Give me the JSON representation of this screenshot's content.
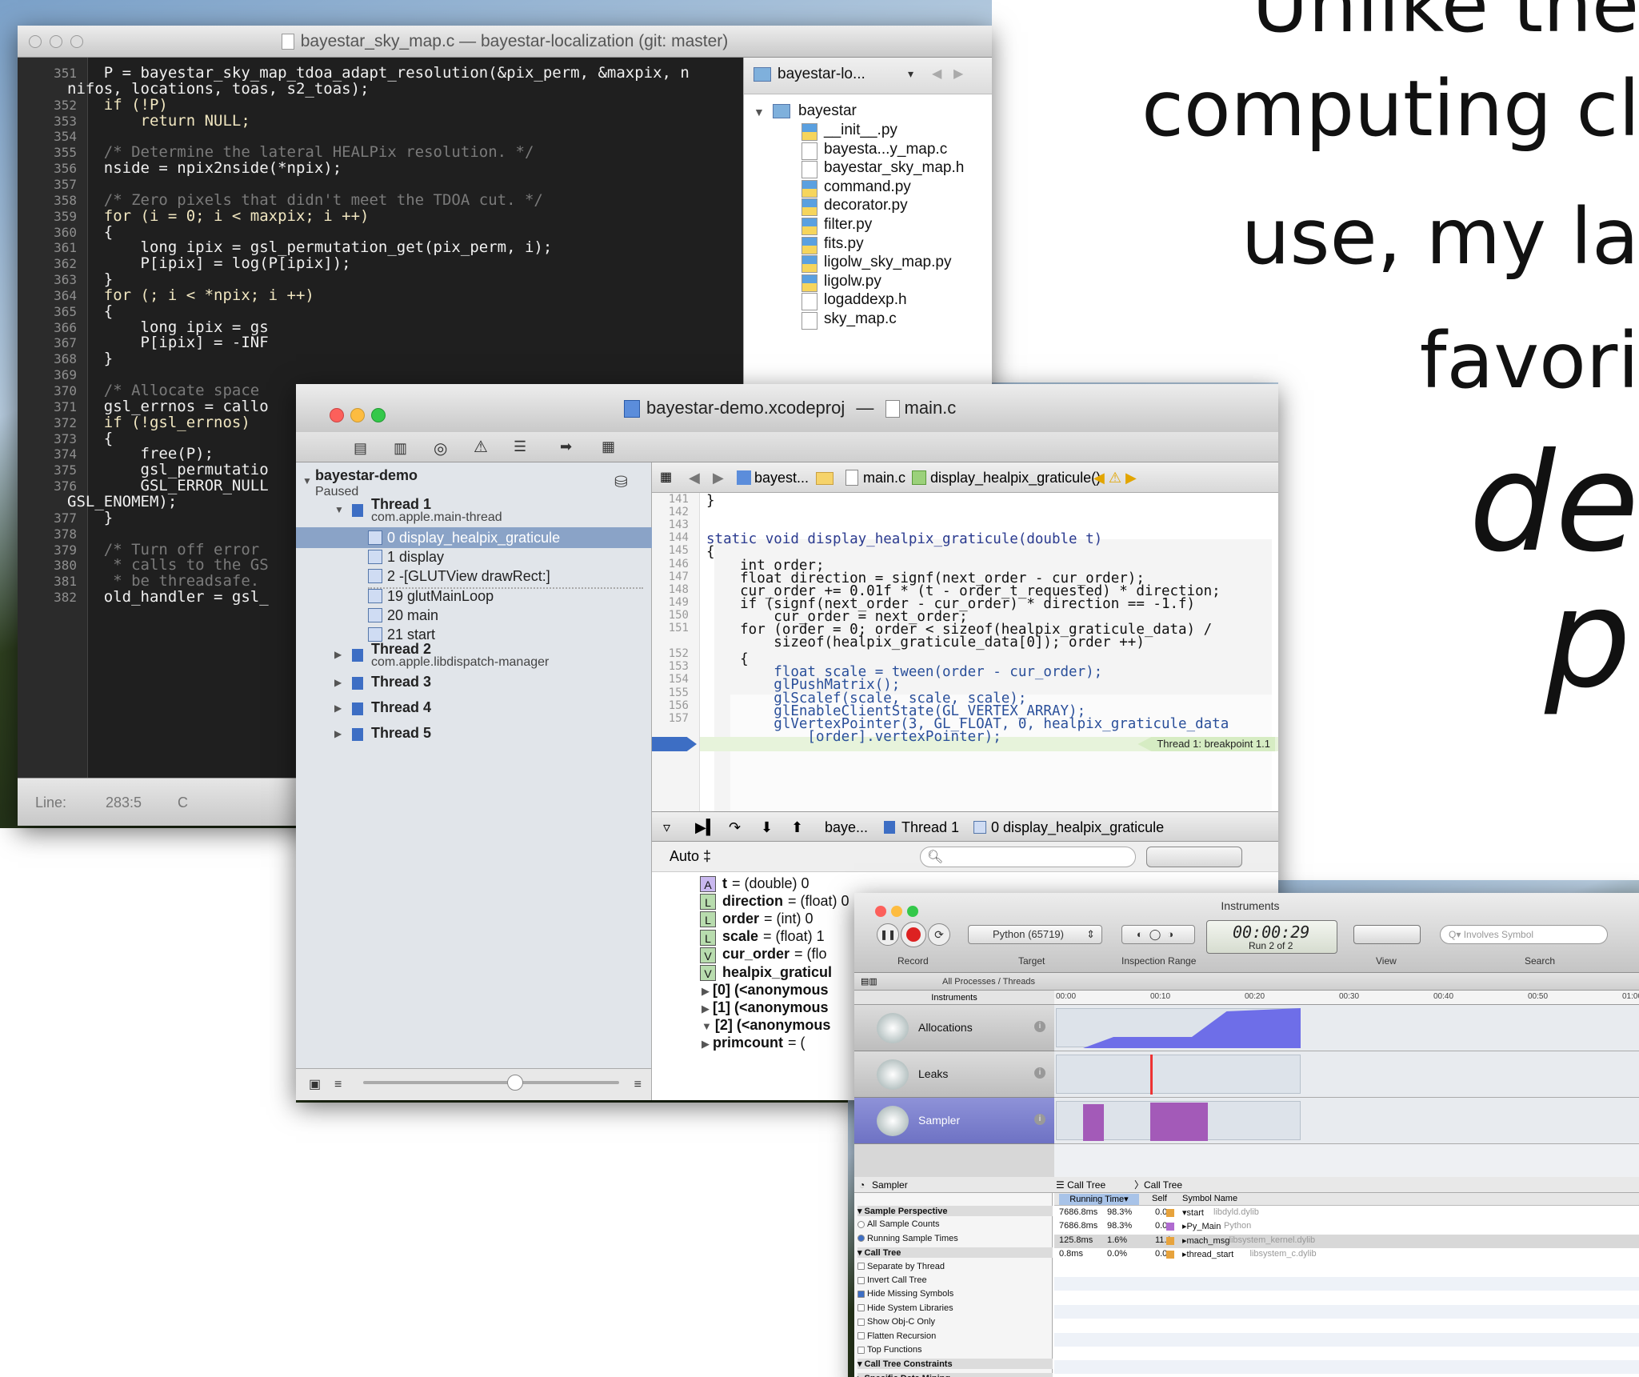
{
  "slide": {
    "line1": "Unlike the",
    "line2": "computing cl",
    "line3": "use, my la",
    "line4": "favori",
    "line5": "de",
    "line6": "p"
  },
  "editor": {
    "title": "bayestar_sky_map.c — bayestar-localization (git: master)",
    "status_line": "Line:",
    "status_pos": "283:5",
    "status_lang": "C",
    "project_selector": "bayestar-lo...",
    "project_folder": "bayestar",
    "files": [
      "__init__.py",
      "bayesta...y_map.c",
      "bayestar_sky_map.h",
      "command.py",
      "decorator.py",
      "filter.py",
      "fits.py",
      "ligolw_sky_map.py",
      "ligolw.py",
      "logaddexp.h",
      "sky_map.c"
    ],
    "line_numbers": [
      "351",
      "",
      "352",
      "353",
      "354",
      "355",
      "356",
      "357",
      "358",
      "359",
      "360",
      "361",
      "362",
      "363",
      "364",
      "365",
      "366",
      "367",
      "368",
      "369",
      "370",
      "371",
      "372",
      "373",
      "374",
      "375",
      "376",
      "",
      "377",
      "378",
      "379",
      "380",
      "381",
      "382"
    ],
    "code": [
      "    P = bayestar_sky_map_tdoa_adapt_resolution(&pix_perm, &maxpix, n",
      "nifos, locations, toas, s2_toas);",
      "    if (!P)",
      "        return NULL;",
      "",
      "    /* Determine the lateral HEALPix resolution. */",
      "    nside = npix2nside(*npix);",
      "",
      "    /* Zero pixels that didn't meet the TDOA cut. */",
      "    for (i = 0; i < maxpix; i ++)",
      "    {",
      "        long ipix = gsl_permutation_get(pix_perm, i);",
      "        P[ipix] = log(P[ipix]);",
      "    }",
      "    for (; i < *npix; i ++)",
      "    {",
      "        long ipix = gs",
      "        P[ipix] = -INF",
      "    }",
      "",
      "    /* Allocate space",
      "    gsl_errnos = callo",
      "    if (!gsl_errnos)",
      "    {",
      "        free(P);",
      "        gsl_permutatio",
      "        GSL_ERROR_NULL",
      "GSL_ENOMEM);",
      "    }",
      "",
      "    /* Turn off error",
      "     * calls to the GS",
      "     * be threadsafe.",
      "    old_handler = gsl_"
    ]
  },
  "xcode": {
    "title_project": "bayestar-demo.xcodeproj",
    "title_sep": "—",
    "title_file": "main.c",
    "jump": {
      "crumb1": "bayest...",
      "crumb2": "main.c",
      "crumb3": "display_healpix_graticule()"
    },
    "target": "bayestar-demo",
    "target_status": "Paused",
    "threads": [
      {
        "name": "Thread 1",
        "sub": "com.apple.main-thread"
      },
      {
        "name": "Thread 2",
        "sub": "com.apple.libdispatch-manager"
      },
      {
        "name": "Thread 3",
        "sub": ""
      },
      {
        "name": "Thread 4",
        "sub": ""
      },
      {
        "name": "Thread 5",
        "sub": ""
      }
    ],
    "frames": [
      "0 display_healpix_graticule",
      "1 display",
      "2 -[GLUTView drawRect:]",
      "19 glutMainLoop",
      "20 main",
      "21 start"
    ],
    "line_numbers": [
      "141",
      "142",
      "143",
      "144",
      "145",
      "146",
      "147",
      "148",
      "149",
      "150",
      "151",
      "",
      "152",
      "153",
      "154",
      "155",
      "156",
      "157"
    ],
    "code": [
      "}",
      "",
      "",
      "static void display_healpix_graticule(double t)",
      "{",
      "    int order;",
      "    float direction = signf(next_order - cur_order);",
      "    cur_order += 0.01f * (t - order_t_requested) * direction;",
      "    if (signf(next_order - cur_order) * direction == -1.f)",
      "        cur_order = next_order;",
      "    for (order = 0; order < sizeof(healpix_graticule_data) /",
      "        sizeof(healpix_graticule_data[0]); order ++)",
      "    {",
      "        float scale = tween(order - cur_order);",
      "        glPushMatrix();",
      "        glScalef(scale, scale, scale);",
      "        glEnableClientState(GL_VERTEX_ARRAY);",
      "        glVertexPointer(3, GL_FLOAT, 0, healpix_graticule_data",
      "            [order].vertexPointer);"
    ],
    "breakpoint_label": "Thread 1: breakpoint 1.1",
    "debugbar": {
      "crumb1": "baye...",
      "crumb2": "Thread 1",
      "crumb3": "0 display_healpix_graticule"
    },
    "auto_label": "Auto ‡",
    "variables": [
      {
        "badge": "A",
        "name": "t",
        "value": "= (double) 0"
      },
      {
        "badge": "L",
        "name": "direction",
        "value": "= (float) 0"
      },
      {
        "badge": "L",
        "name": "order",
        "value": "= (int) 0"
      },
      {
        "badge": "L",
        "name": "scale",
        "value": "= (float) 1"
      },
      {
        "badge": "V",
        "name": "cur_order",
        "value": "= (flo"
      },
      {
        "badge": "V",
        "name": "healpix_graticul",
        "value": ""
      },
      {
        "badge": "",
        "name": "[0] (<anonymous",
        "value": ""
      },
      {
        "badge": "",
        "name": "[1] (<anonymous",
        "value": ""
      },
      {
        "badge": "",
        "name": "[2] (<anonymous",
        "value": ""
      },
      {
        "badge": "",
        "name": "primcount",
        "value": "= ("
      }
    ]
  },
  "instruments": {
    "title": "Instruments",
    "target": "Python (65719)",
    "time": "00:00:29",
    "run": "Run 2 of 2",
    "search_placeholder": "Involves Symbol",
    "labels": {
      "record": "Record",
      "target": "Target",
      "range": "Inspection Range",
      "view": "View",
      "search": "Search"
    },
    "scope": "All Processes / Threads",
    "instruments_header": "Instruments",
    "ruler": [
      "00:00",
      "00:10",
      "00:20",
      "00:30",
      "00:40",
      "00:50",
      "01:00"
    ],
    "rows": [
      "Allocations",
      "Leaks",
      "Sampler"
    ],
    "sampler_header": "Sampler",
    "call_tree": "Call Tree",
    "call_tree2": "Call Tree",
    "options": [
      "Sample Perspective",
      "All Sample Counts",
      "Running Sample Times",
      "Call Tree",
      "Separate by Thread",
      "Invert Call Tree",
      "Hide Missing Symbols",
      "Hide System Libraries",
      "Show Obj-C Only",
      "Flatten Recursion",
      "Top Functions",
      "Call Tree Constraints",
      "Specific Data Mining"
    ],
    "columns": [
      "Running Time▾",
      "Self",
      "Symbol Name"
    ],
    "table": [
      {
        "time": "7686.8ms",
        "pct": "98.3%",
        "self": "0.0",
        "sym": "▾start",
        "lib": "libdyld.dylib"
      },
      {
        "time": "7686.8ms",
        "pct": "98.3%",
        "self": "0.0",
        "sym": "▸Py_Main",
        "lib": "Python"
      },
      {
        "time": "125.8ms",
        "pct": "1.6%",
        "self": "11.1",
        "sym": "▸mach_msg",
        "lib": "libsystem_kernel.dylib"
      },
      {
        "time": "0.8ms",
        "pct": "0.0%",
        "self": "0.0",
        "sym": "▸thread_start",
        "lib": "libsystem_c.dylib"
      }
    ]
  }
}
